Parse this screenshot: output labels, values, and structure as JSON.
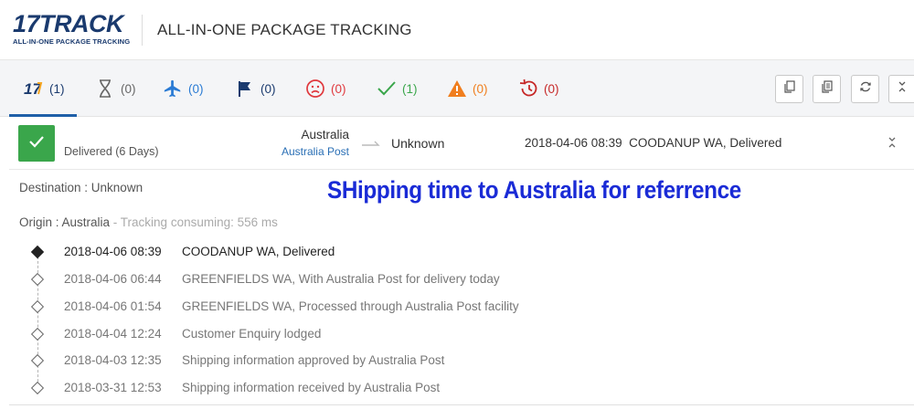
{
  "header": {
    "logo_main": "17TRACK",
    "logo_num": "17",
    "logo_word": "TRACK",
    "logo_sub": "ALL-IN-ONE PACKAGE TRACKING",
    "title": "ALL-IN-ONE PACKAGE TRACKING"
  },
  "tabs": [
    {
      "icon": "17track-logo-icon",
      "count": "(1)",
      "color": "#1a3a6e"
    },
    {
      "icon": "hourglass-icon",
      "count": "(0)",
      "color": "#666666"
    },
    {
      "icon": "airplane-icon",
      "count": "(0)",
      "color": "#2a7bd4"
    },
    {
      "icon": "flag-icon",
      "count": "(0)",
      "color": "#1a3a6e"
    },
    {
      "icon": "sad-face-icon",
      "count": "(0)",
      "color": "#e0393e"
    },
    {
      "icon": "checkmark-icon",
      "count": "(1)",
      "color": "#3aa64b"
    },
    {
      "icon": "warning-icon",
      "count": "(0)",
      "color": "#f07e1e"
    },
    {
      "icon": "history-icon",
      "count": "(0)",
      "color": "#c62828"
    }
  ],
  "toolbar": {
    "buttons": [
      "copy-icon",
      "copy-list-icon",
      "refresh-icon",
      "collapse-icon"
    ]
  },
  "summary": {
    "status": "Delivered (6 Days)",
    "status_color": "#3aa64b",
    "origin_country": "Australia",
    "carrier": "Australia Post",
    "destination": "Unknown",
    "latest_event": "2018-04-06 08:39  COODANUP WA, Delivered"
  },
  "details": {
    "destination_line": "Destination : Unknown",
    "origin_line": "Origin : Australia",
    "tracking_consuming": " - Tracking consuming: 556 ms"
  },
  "overlay_text": "SHipping time to Australia for referrence",
  "events": [
    {
      "time": "2018-04-06 08:39",
      "desc": "COODANUP WA, Delivered"
    },
    {
      "time": "2018-04-06 06:44",
      "desc": "GREENFIELDS WA, With Australia Post for delivery today"
    },
    {
      "time": "2018-04-06 01:54",
      "desc": "GREENFIELDS WA, Processed through Australia Post facility"
    },
    {
      "time": "2018-04-04 12:24",
      "desc": "Customer Enquiry lodged"
    },
    {
      "time": "2018-04-03 12:35",
      "desc": "Shipping information approved by Australia Post"
    },
    {
      "time": "2018-03-31 12:53",
      "desc": "Shipping information received by Australia Post"
    }
  ]
}
